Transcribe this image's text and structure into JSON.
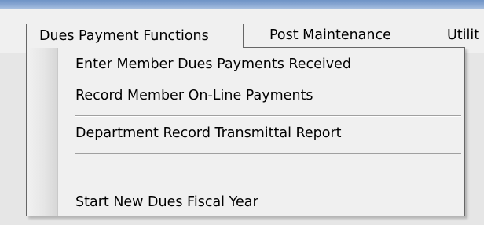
{
  "menubar": {
    "items": [
      {
        "label": "Dues Payment Functions",
        "state": "open"
      },
      {
        "label": "Post Maintenance"
      },
      {
        "label": "Utilit"
      }
    ]
  },
  "dropdown": {
    "items": [
      {
        "label": "Enter Member Dues Payments Received"
      },
      {
        "label": "Record Member On-Line Payments"
      },
      {
        "label": "Department Record Transmittal Report"
      },
      {
        "label": ""
      },
      {
        "label": "Start New Dues Fiscal Year"
      }
    ]
  },
  "colors": {
    "title_strip": "#8aa8d3",
    "menu_background": "#f0f0f0",
    "menu_border": "#666666",
    "separator": "#a0a0a0"
  }
}
